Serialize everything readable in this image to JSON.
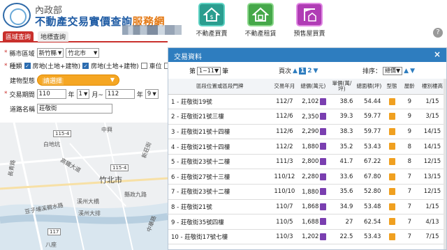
{
  "header": {
    "ministry": "內政部",
    "title_main": "不動產交易實價查詢",
    "title_suffix": "服務網",
    "nav": [
      {
        "label": "不動產買賣",
        "icon": "house-dollar-icon"
      },
      {
        "label": "不動產租賃",
        "icon": "house-rent-icon"
      },
      {
        "label": "預售屋買賣",
        "icon": "crane-house-icon"
      }
    ],
    "help": "?"
  },
  "tabs": {
    "area": "區域查詢",
    "landmark": "地標查詢"
  },
  "form": {
    "county_label": "縣市區域",
    "county": "新竹縣",
    "district": "竹北市",
    "kind_label": "種類",
    "kind_options": [
      {
        "label": "房地(土地+建物)",
        "checked": true
      },
      {
        "label": "房地(土地+建物)",
        "checked": true
      },
      {
        "label": "車位",
        "checked": false
      },
      {
        "label": "土",
        "checked": false
      }
    ],
    "building_type_label": "建物型態",
    "building_type_placeholder": "請選擇",
    "period_label": "交易期間",
    "from_year": "110",
    "from_year_suffix": "年",
    "from_month": "1",
    "from_month_suffix": "月~",
    "to_year": "112",
    "to_year_suffix": "年",
    "to_month": "9",
    "road_label": "道路名稱",
    "road_value": "莊敬街"
  },
  "map": {
    "city": "竹北市",
    "labels": [
      "白地坑",
      "高鐵大道",
      "新莊街",
      "溪州大橋",
      "中興",
      "長青路",
      "縣政九路",
      "豆子埔溪親水路",
      "溪州大排",
      "中華路",
      "八座"
    ],
    "highways": [
      "115-4",
      "115-4",
      "117"
    ]
  },
  "panel": {
    "title": "交易資料",
    "close": "×",
    "page_prefix": "第",
    "page_select": "1~11",
    "page_suffix": "筆",
    "page_label": "頁次",
    "page_current": "1",
    "page_next": "2",
    "sort_label": "排序：",
    "sort_value": "總價",
    "columns": [
      "區段位置或區段門牌",
      "交易年月",
      "總價(萬元)",
      "單價(萬/坪)",
      "總面積(坪)",
      "型態",
      "屋齡",
      "樓別樓高"
    ],
    "rows": [
      {
        "addr": "1 - 莊敬街19號",
        "ym": "112/7",
        "total": "2,102",
        "unit": "38.6",
        "area": "54.44",
        "age": "9",
        "floor": "1/15"
      },
      {
        "addr": "2 - 莊敬街21號三樓",
        "ym": "112/6",
        "total": "2,350",
        "unit": "39.3",
        "area": "59.77",
        "age": "9",
        "floor": "3/15"
      },
      {
        "addr": "3 - 莊敬街21號十四樓",
        "ym": "112/6",
        "total": "2,290",
        "unit": "38.3",
        "area": "59.77",
        "age": "9",
        "floor": "14/15"
      },
      {
        "addr": "4 - 莊敬街21號十四樓",
        "ym": "112/2",
        "total": "1,880",
        "unit": "35.2",
        "area": "53.43",
        "age": "8",
        "floor": "14/15"
      },
      {
        "addr": "5 - 莊敬街23號十二樓",
        "ym": "111/3",
        "total": "2,800",
        "unit": "41.7",
        "area": "67.22",
        "age": "8",
        "floor": "12/15"
      },
      {
        "addr": "6 - 莊敬街27號十三樓",
        "ym": "110/12",
        "total": "2,280",
        "unit": "33.6",
        "area": "67.80",
        "age": "7",
        "floor": "13/15"
      },
      {
        "addr": "7 - 莊敬街23號十二樓",
        "ym": "110/10",
        "total": "1,880",
        "unit": "35.6",
        "area": "52.80",
        "age": "7",
        "floor": "12/15"
      },
      {
        "addr": "8 - 莊敬街21號",
        "ym": "110/7",
        "total": "1,868",
        "unit": "34.9",
        "area": "53.48",
        "age": "7",
        "floor": "1/15"
      },
      {
        "addr": "9 - 莊敬街35號四樓",
        "ym": "110/5",
        "total": "1,688",
        "unit": "27",
        "area": "62.54",
        "age": "7",
        "floor": "4/13"
      },
      {
        "addr": "10 - 莊敬街17號七樓",
        "ym": "110/3",
        "total": "1,202",
        "unit": "22.5",
        "area": "53.43",
        "age": "7",
        "floor": "7/15"
      }
    ],
    "type_badge": "住"
  }
}
